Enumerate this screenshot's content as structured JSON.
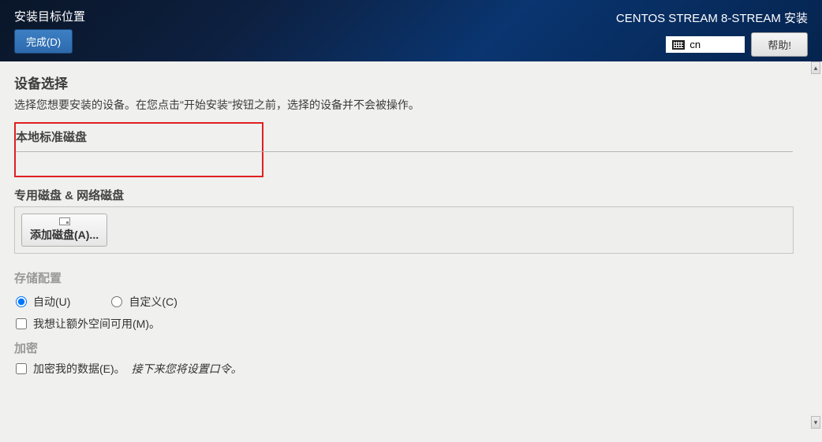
{
  "header": {
    "title": "安装目标位置",
    "done_button": "完成(D)",
    "product": "CENTOS STREAM 8-STREAM 安装",
    "lang": "cn",
    "help_button": "帮助!"
  },
  "sections": {
    "device_select": {
      "title": "设备选择",
      "desc": "选择您想要安装的设备。在您点击\"开始安装\"按钮之前，选择的设备并不会被操作。"
    },
    "local_disks": {
      "title": "本地标准磁盘"
    },
    "special_disks": {
      "title": "专用磁盘 & 网络磁盘",
      "add_button": "添加磁盘(A)..."
    },
    "storage_config": {
      "title": "存储配置"
    },
    "encryption": {
      "title": "加密"
    }
  },
  "options": {
    "auto": {
      "label": "自动(U)",
      "checked": true
    },
    "custom": {
      "label": "自定义(C)",
      "checked": false
    },
    "extra_space": {
      "label": "我想让额外空间可用(M)。",
      "checked": false
    },
    "encrypt": {
      "label": "加密我的数据(E)。",
      "checked": false,
      "note": "接下来您将设置口令。"
    }
  }
}
